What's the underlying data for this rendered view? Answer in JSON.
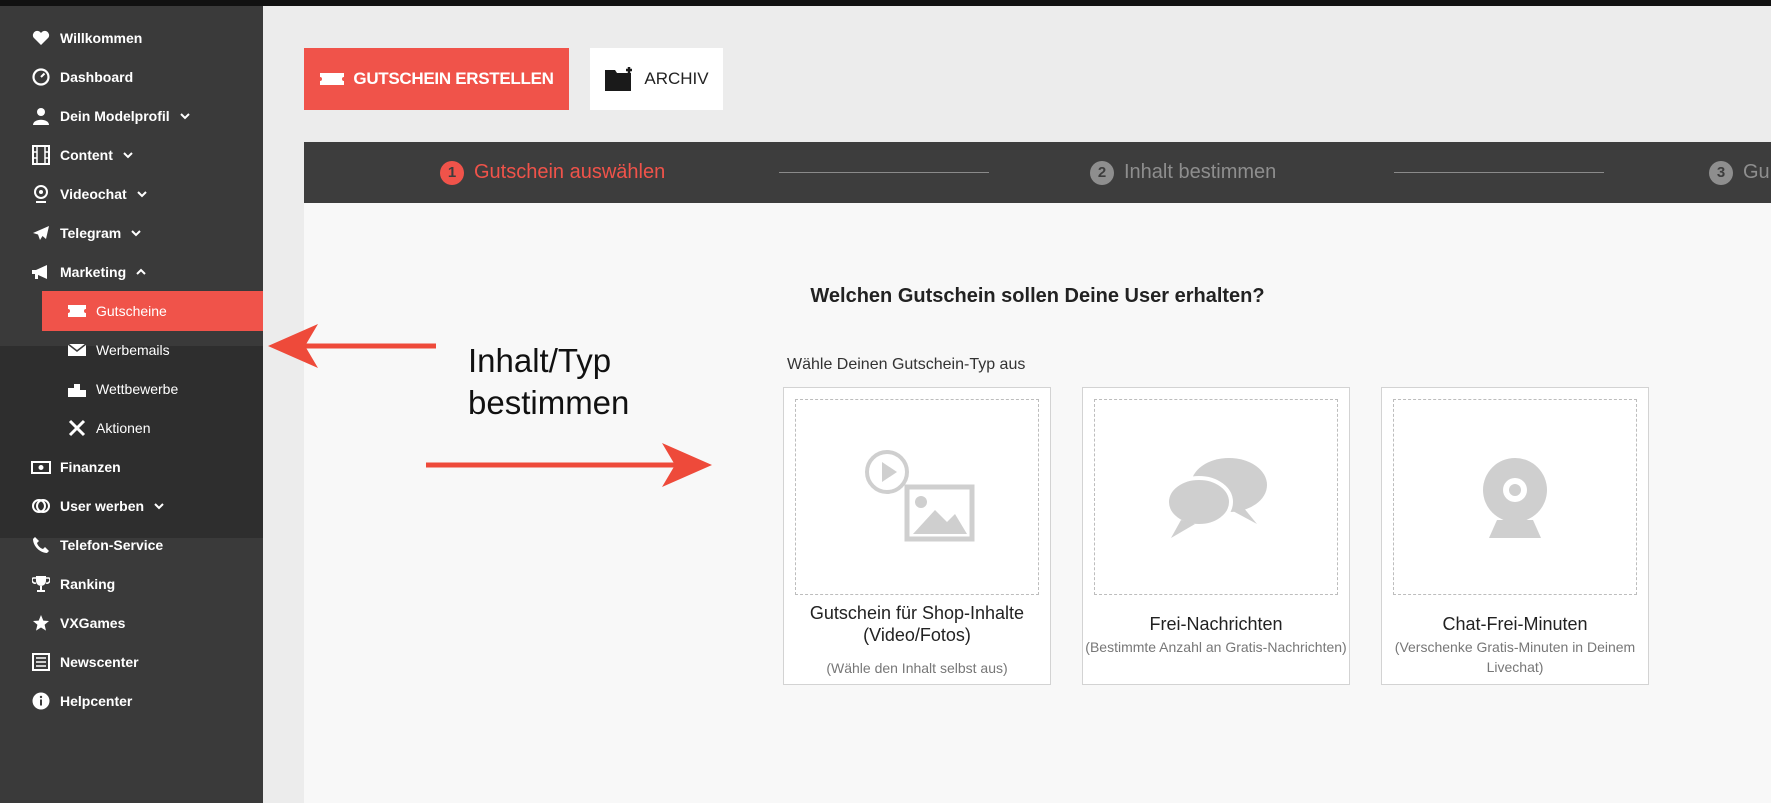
{
  "sidebar": {
    "items": [
      {
        "label": "Willkommen",
        "icon": "heart-icon"
      },
      {
        "label": "Dashboard",
        "icon": "gauge-icon"
      },
      {
        "label": "Dein Modelprofil",
        "icon": "user-icon",
        "chevron": "down"
      },
      {
        "label": "Content",
        "icon": "film-icon",
        "chevron": "down"
      },
      {
        "label": "Videochat",
        "icon": "webcam-icon",
        "chevron": "down"
      },
      {
        "label": "Telegram",
        "icon": "paper-plane-icon",
        "chevron": "down"
      },
      {
        "label": "Marketing",
        "icon": "megaphone-icon",
        "chevron": "up"
      },
      {
        "label": "Gutscheine",
        "icon": "ticket-icon",
        "active": true
      },
      {
        "label": "Werbemails",
        "icon": "envelope-icon"
      },
      {
        "label": "Wettbewerbe",
        "icon": "trophy-stand-icon"
      },
      {
        "label": "Aktionen",
        "icon": "tools-icon"
      },
      {
        "label": "Finanzen",
        "icon": "money-icon"
      },
      {
        "label": "User werben",
        "icon": "coins-icon",
        "chevron": "down"
      },
      {
        "label": "Telefon-Service",
        "icon": "phone-icon"
      },
      {
        "label": "Ranking",
        "icon": "trophy-icon"
      },
      {
        "label": "VXGames",
        "icon": "star-icon"
      },
      {
        "label": "Newscenter",
        "icon": "news-icon"
      },
      {
        "label": "Helpcenter",
        "icon": "info-icon"
      }
    ]
  },
  "toolbar": {
    "create_label": "GUTSCHEIN ERSTELLEN",
    "archive_label": "ARCHIV"
  },
  "stepper": {
    "steps": [
      {
        "num": "1",
        "label": "Gutschein auswählen",
        "active": true
      },
      {
        "num": "2",
        "label": "Inhalt bestimmen",
        "active": false
      },
      {
        "num": "3",
        "label": "Gu",
        "active": false
      }
    ]
  },
  "main": {
    "question": "Welchen Gutschein sollen Deine User erhalten?",
    "choose_label": "Wähle Deinen Gutschein-Typ aus",
    "cards": [
      {
        "title": "Gutschein für Shop-Inhalte (Video/Fotos)",
        "desc": "(Wähle den Inhalt selbst aus)",
        "icon": "media-icon"
      },
      {
        "title": "Frei-Nachrichten",
        "desc": "(Bestimmte Anzahl an Gratis-Nachrichten)",
        "icon": "chat-bubbles-icon"
      },
      {
        "title": "Chat-Frei-Minuten",
        "desc": "(Verschenke Gratis-Minuten in Deinem Livechat)",
        "icon": "webcam-icon"
      }
    ]
  },
  "annotation": {
    "line1": "Inhalt/Typ",
    "line2": "bestimmen"
  },
  "colors": {
    "accent": "#f0534a",
    "sidebar_bg": "#3a3a3a",
    "stepper_bg": "#3d3d3d",
    "arrow": "#ee4a3a"
  }
}
